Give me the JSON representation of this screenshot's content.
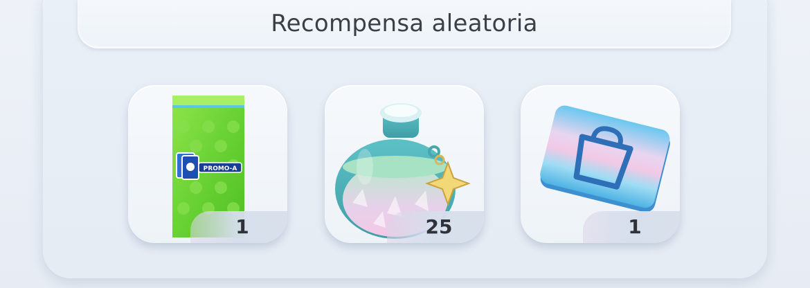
{
  "header": {
    "title": "Recompensa aleatoria"
  },
  "rewards": [
    {
      "icon": "promo-a-pack-icon",
      "quantity": "1"
    },
    {
      "icon": "shinedust-bottle-icon",
      "quantity": "25"
    },
    {
      "icon": "shop-ticket-icon",
      "quantity": "1"
    }
  ],
  "colors": {
    "pack_green": "#6fd23a",
    "bottle_teal": "#4fb1b7",
    "ticket_blue": "#4fb6e6",
    "text": "#2f3238"
  },
  "badge_text": "PROMO-A"
}
